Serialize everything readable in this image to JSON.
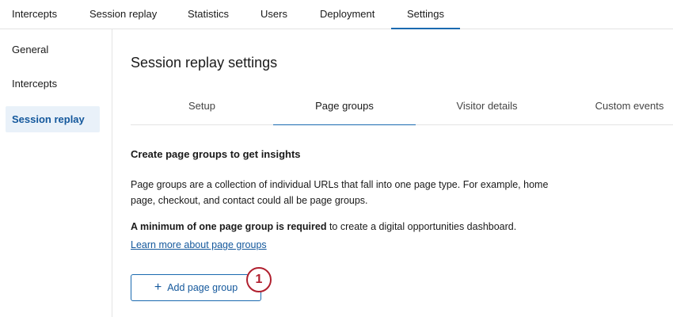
{
  "top_nav": {
    "tabs": [
      "Intercepts",
      "Session replay",
      "Statistics",
      "Users",
      "Deployment",
      "Settings"
    ],
    "active": "Settings"
  },
  "sidebar": {
    "items": [
      "General",
      "Intercepts",
      "Session replay"
    ],
    "active": "Session replay"
  },
  "main": {
    "title": "Session replay settings",
    "sub_tabs": [
      "Setup",
      "Page groups",
      "Visitor details",
      "Custom events"
    ],
    "active_sub_tab": "Page groups",
    "heading": "Create page groups to get insights",
    "description": "Page groups are a collection of individual URLs that fall into one page type. For example, home page, checkout, and contact could all be page groups.",
    "requirement_bold": "A minimum of one page group is required",
    "requirement_rest": " to create a digital opportunities dashboard.",
    "learn_more_link": "Learn more about page groups",
    "add_button_icon": "+",
    "add_button_label": "Add page group",
    "callout_number": "1"
  },
  "colors": {
    "accent": "#1a6ab0",
    "link": "#14589c",
    "sidebar_active_bg": "#e9f1f9",
    "callout": "#b01f2e"
  }
}
